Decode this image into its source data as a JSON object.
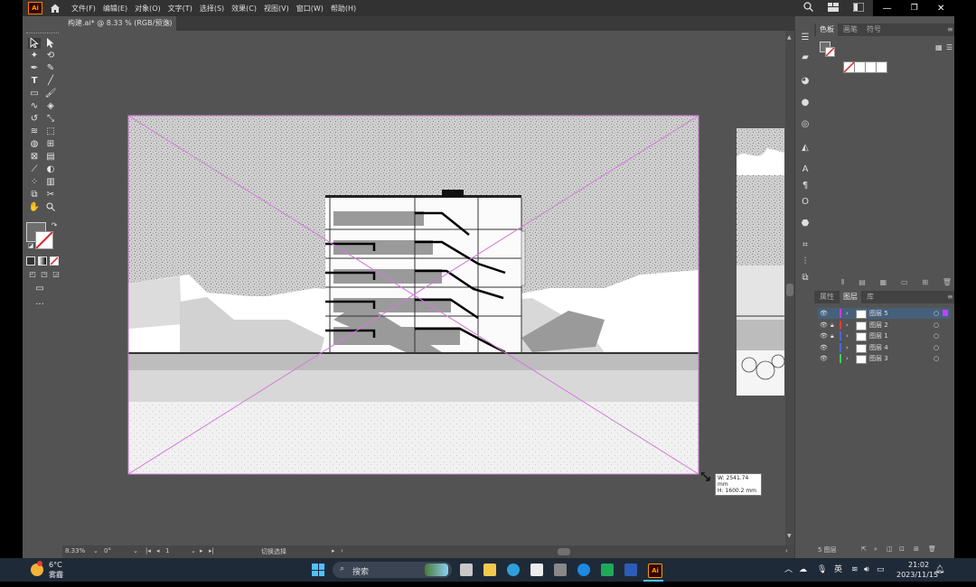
{
  "app": {
    "logo": "Ai",
    "menus": [
      "文件(F)",
      "编辑(E)",
      "对象(O)",
      "文字(T)",
      "选择(S)",
      "效果(C)",
      "视图(V)",
      "窗口(W)",
      "帮助(H)"
    ]
  },
  "document_tab": {
    "title": "构建.ai* @ 8.33 % (RGB/预览)",
    "close": "×"
  },
  "info_tooltip": {
    "width": "W: 2541.74 mm",
    "height": "H: 1600.2 mm"
  },
  "status_bar": {
    "zoom": "8.33%",
    "rotation": "0°",
    "artboard": "1",
    "tool": "切换选择"
  },
  "panels": {
    "top_tabs": [
      "色板",
      "画笔",
      "符号"
    ],
    "layers_tabs": [
      "属性",
      "图层",
      "库"
    ],
    "layers": [
      {
        "name": "图层 5",
        "color": "#c040ff",
        "locked": false,
        "selected": true
      },
      {
        "name": "图层 2",
        "color": "#e03a3a",
        "locked": true,
        "selected": false
      },
      {
        "name": "图层 1",
        "color": "#4b62ff",
        "locked": true,
        "selected": false
      },
      {
        "name": "图层 4",
        "color": "#4b62ff",
        "locked": false,
        "selected": false
      },
      {
        "name": "图层 3",
        "color": "#3cd05a",
        "locked": false,
        "selected": false
      }
    ],
    "layers_footer": "5 图层"
  },
  "taskbar": {
    "weather_temp": "6°C",
    "weather_desc": "雾霾",
    "search_placeholder": "搜索",
    "ime": "英",
    "time": "21:02",
    "date": "2023/11/15"
  },
  "colors": {
    "artboard_guide": "#d27ad9",
    "accent_ai": "#ff9a00"
  }
}
